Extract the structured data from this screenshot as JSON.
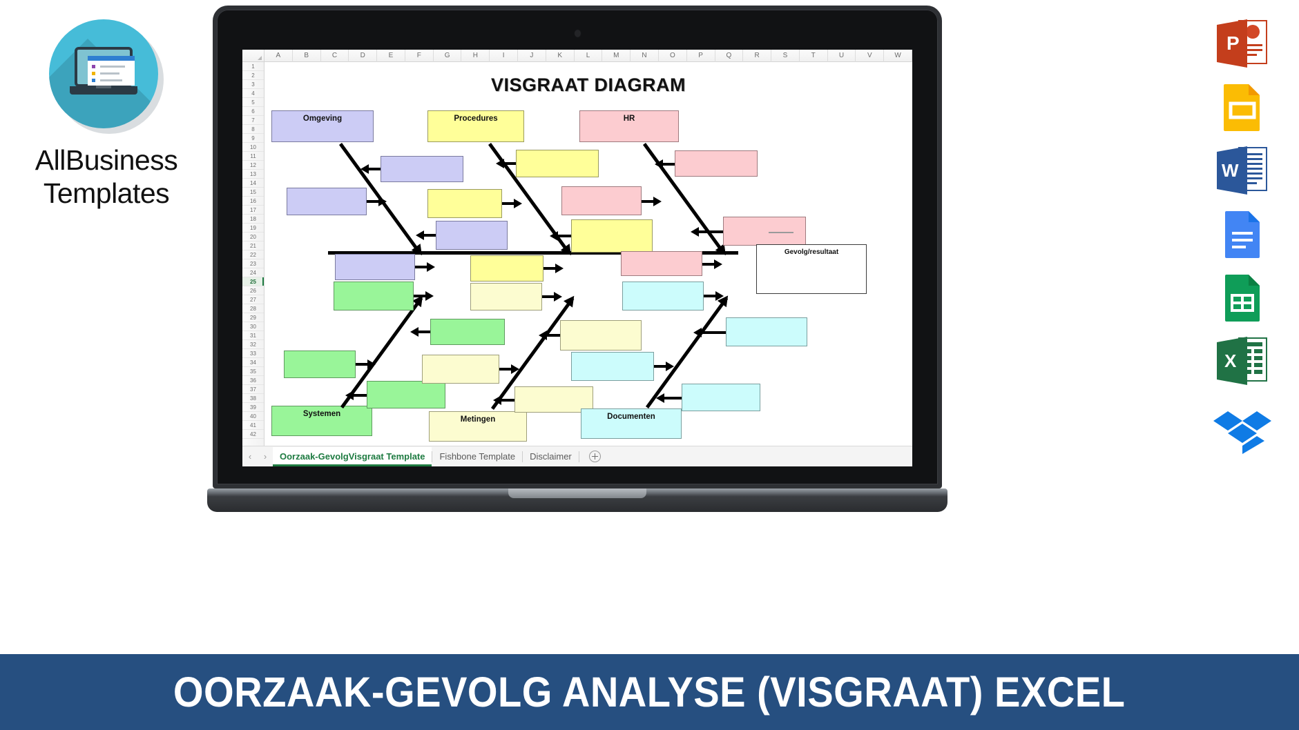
{
  "brand": {
    "name_line1": "AllBusiness",
    "name_line2": "Templates",
    "logo_icon": "laptop-template-icon",
    "accent_color": "#46bcd8"
  },
  "banner": {
    "text": "OORZAAK-GEVOLG ANALYSE (VISGRAAT) EXCEL",
    "background_color": "#264f80",
    "text_color": "#ffffff"
  },
  "spreadsheet": {
    "columns": [
      "A",
      "B",
      "C",
      "D",
      "E",
      "F",
      "G",
      "H",
      "I",
      "J",
      "K",
      "L",
      "M",
      "N",
      "O",
      "P",
      "Q",
      "R",
      "S",
      "T",
      "U",
      "V",
      "W"
    ],
    "rows": [
      "1",
      "2",
      "3",
      "4",
      "5",
      "6",
      "7",
      "8",
      "9",
      "10",
      "11",
      "12",
      "13",
      "14",
      "15",
      "16",
      "17",
      "18",
      "19",
      "20",
      "21",
      "22",
      "23",
      "24",
      "25",
      "26",
      "27",
      "28",
      "29",
      "30",
      "31",
      "32",
      "33",
      "34",
      "35",
      "36",
      "37",
      "38",
      "39",
      "40",
      "41",
      "42"
    ],
    "selected_row": "25",
    "tabs": [
      {
        "label": "Oorzaak-GevolgVisgraat Template",
        "active": true
      },
      {
        "label": "Fishbone Template",
        "active": false
      },
      {
        "label": "Disclaimer",
        "active": false
      }
    ],
    "add_sheet_label": "+",
    "nav_prev_icon": "chevron-left-icon",
    "nav_next_icon": "chevron-right-icon",
    "accent_color": "#1e7b41"
  },
  "diagram": {
    "title": "VISGRAAT DIAGRAM",
    "type": "fishbone",
    "result_box": {
      "label": "Gevolg/resultaat",
      "fill": "#ffffff"
    },
    "categories": [
      {
        "name": "Omgeving",
        "position": "top",
        "fill": "#ccccf5",
        "cause_count": 4
      },
      {
        "name": "Procedures",
        "position": "top",
        "fill": "#ffff99",
        "cause_count": 4
      },
      {
        "name": "HR",
        "position": "top",
        "fill": "#fcccd0",
        "cause_count": 4
      },
      {
        "name": "Systemen",
        "position": "bottom",
        "fill": "#99f599",
        "cause_count": 4
      },
      {
        "name": "Metingen",
        "position": "bottom",
        "fill": "#fcfcd0",
        "cause_count": 4
      },
      {
        "name": "Documenten",
        "position": "bottom",
        "fill": "#ccfcfc",
        "cause_count": 4
      }
    ],
    "cause_boxes_empty": true
  },
  "app_icons": [
    {
      "name": "powerpoint-icon",
      "letter": "P",
      "color": "#d24726"
    },
    {
      "name": "google-slides-icon",
      "letter": "",
      "color": "#fbbc04"
    },
    {
      "name": "word-icon",
      "letter": "W",
      "color": "#2b579a"
    },
    {
      "name": "google-docs-icon",
      "letter": "",
      "color": "#4285f4"
    },
    {
      "name": "google-sheets-icon",
      "letter": "",
      "color": "#0f9d58"
    },
    {
      "name": "excel-icon",
      "letter": "X",
      "color": "#207245"
    },
    {
      "name": "dropbox-icon",
      "letter": "",
      "color": "#0061fe"
    }
  ]
}
